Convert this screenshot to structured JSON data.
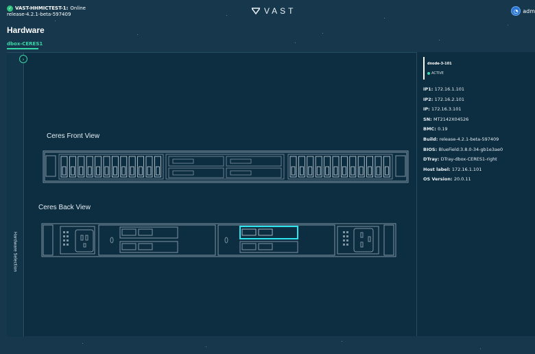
{
  "header": {
    "cluster_name": "VAST-HHMICTEST-1:",
    "cluster_status": "Online",
    "release": "release-4.2.1-beta-597409",
    "logo_text": "VAST",
    "user_label": "adm"
  },
  "page": {
    "title": "Hardware",
    "dbox_tab": "dbox-CERES1"
  },
  "sidebar": {
    "label": "Hardware Selection",
    "collapse_icon": "chevron-right-icon"
  },
  "views": {
    "front_title": "Ceres Front View",
    "back_title": "Ceres Back View"
  },
  "node": {
    "name": "dnode-3-101",
    "state": "ACTIVE",
    "fields": [
      {
        "label": "IP1:",
        "value": "172.16.1.101"
      },
      {
        "label": "IP2:",
        "value": "172.16.2.101"
      },
      {
        "label": "IP:",
        "value": "172.16.3.101"
      },
      {
        "label": "SN:",
        "value": "MT2142X04526"
      },
      {
        "label": "BMC:",
        "value": "0.19"
      },
      {
        "label": "Build:",
        "value": "release-4.2.1-beta-597409"
      },
      {
        "label": "BIOS:",
        "value": "BlueField:3.8.0-34-gb1e3ae0"
      },
      {
        "label": "DTray:",
        "value": "DTray-dbox-CERES1-right"
      },
      {
        "label": "Host label:",
        "value": "172.16.1.101"
      },
      {
        "label": "OS Version:",
        "value": "20.0.11"
      }
    ]
  },
  "colors": {
    "accent": "#38d9a9",
    "selected_outline": "#2ee6f0",
    "background": "#17384c",
    "panel": "#0d2d40"
  }
}
